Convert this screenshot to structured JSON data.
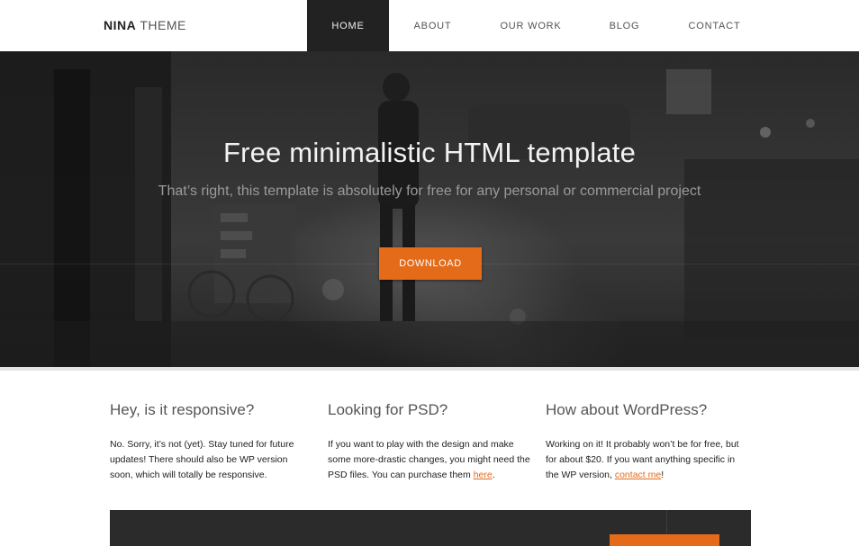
{
  "header": {
    "logo_bold": "NINA",
    "logo_light": " THEME",
    "nav": [
      {
        "label": "HOME",
        "active": true
      },
      {
        "label": "ABOUT",
        "active": false
      },
      {
        "label": "OUR WORK",
        "active": false
      },
      {
        "label": "BLOG",
        "active": false
      },
      {
        "label": "CONTACT",
        "active": false
      }
    ]
  },
  "hero": {
    "title": "Free minimalistic HTML template",
    "subtitle": "That’s right, this template is absolutely for free for any personal or commercial project",
    "button_label": "DOWNLOAD"
  },
  "features": [
    {
      "title": "Hey, is it responsive?",
      "text": "No. Sorry, it’s not (yet). Stay tuned for future updates! There should also be WP version soon, which will totally be responsive.",
      "link": "",
      "after": ""
    },
    {
      "title": "Looking for PSD?",
      "text": "If you want to play with the design and make some more-drastic changes, you might need the PSD files. You can purchase them ",
      "link": "here",
      "after": "."
    },
    {
      "title": "How about WordPress?",
      "text": "Working on it! It probably won’t be for free, but for about $20. If you want anything specific in the WP version, ",
      "link": "contact me",
      "after": "!"
    }
  ],
  "colors": {
    "accent": "#e36b1a",
    "nav_active_bg": "#222222",
    "hero_bg": "#333333",
    "band_bg": "#2b2b2b"
  }
}
